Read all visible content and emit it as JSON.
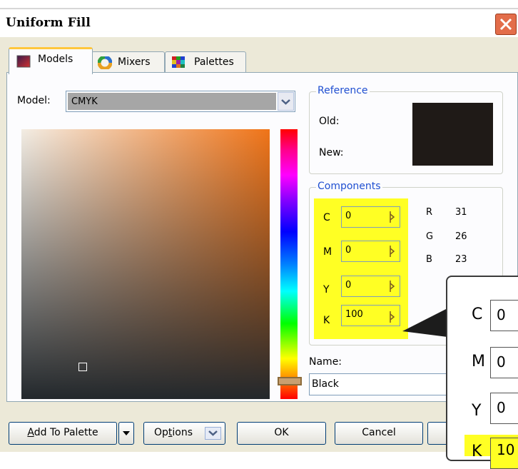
{
  "window": {
    "title": "Uniform Fill"
  },
  "tabs": [
    {
      "label": "Models",
      "active": true
    },
    {
      "label": "Mixers",
      "active": false
    },
    {
      "label": "Palettes",
      "active": false
    }
  ],
  "model": {
    "label": "Model:",
    "value": "CMYK"
  },
  "reference": {
    "title": "Reference",
    "old_label": "Old:",
    "new_label": "New:",
    "swatch_color": "#1f1a17"
  },
  "components": {
    "title": "Components",
    "cmyk": [
      {
        "label": "C",
        "value": "0"
      },
      {
        "label": "M",
        "value": "0"
      },
      {
        "label": "Y",
        "value": "0"
      },
      {
        "label": "K",
        "value": "100"
      }
    ],
    "rgb": [
      {
        "label": "R",
        "value": "31"
      },
      {
        "label": "G",
        "value": "26"
      },
      {
        "label": "B",
        "value": "23"
      }
    ]
  },
  "name": {
    "label": "Name:",
    "value": "Black"
  },
  "buttons": {
    "add_to_palette": "Add To Palette",
    "options": "Options",
    "ok": "OK",
    "cancel": "Cancel"
  },
  "zoom_callout": {
    "rows": [
      {
        "label": "C",
        "value": "0"
      },
      {
        "label": "M",
        "value": "0"
      },
      {
        "label": "Y",
        "value": "0"
      },
      {
        "label": "K",
        "value": "10"
      }
    ]
  },
  "colors": {
    "highlight": "#ffff24",
    "group_title": "#1f4fd1",
    "dialog_bg": "#ece9d8"
  }
}
